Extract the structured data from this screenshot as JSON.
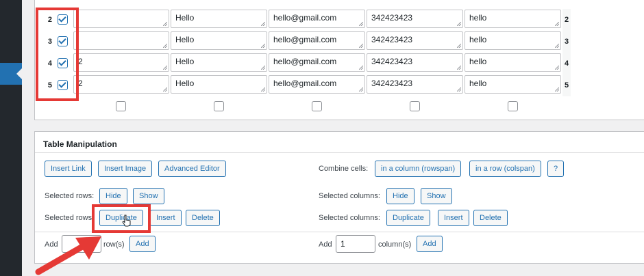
{
  "rows": [
    {
      "num": "2",
      "cells": [
        "",
        "Hello",
        "hello@gmail.com",
        "342423423",
        "hello"
      ]
    },
    {
      "num": "3",
      "cells": [
        "",
        "Hello",
        "hello@gmail.com",
        "342423423",
        "hello"
      ]
    },
    {
      "num": "4",
      "cells": [
        "2",
        "Hello",
        "hello@gmail.com",
        "342423423",
        "hello"
      ]
    },
    {
      "num": "5",
      "cells": [
        "2",
        "Hello",
        "hello@gmail.com",
        "342423423",
        "hello"
      ]
    }
  ],
  "manipulation": {
    "title": "Table Manipulation",
    "insert_link": "Insert Link",
    "insert_image": "Insert Image",
    "advanced_editor": "Advanced Editor",
    "combine_cells_label": "Combine cells:",
    "rowspan": "in a column (rowspan)",
    "colspan": "in a row (colspan)",
    "help": "?",
    "selected_rows_label": "Selected rows:",
    "selected_rows_label2": "Selected rows",
    "selected_columns_label": "Selected columns:",
    "hide": "Hide",
    "show": "Show",
    "duplicate": "Duplicate",
    "insert": "Insert",
    "delete": "Delete",
    "add_label": "Add",
    "rows_suffix": "row(s)",
    "columns_suffix": "column(s)",
    "add_button": "Add",
    "add_rows_value": "",
    "add_columns_value": "1"
  },
  "colors": {
    "accent": "#2271b1",
    "highlight": "#e53935"
  }
}
